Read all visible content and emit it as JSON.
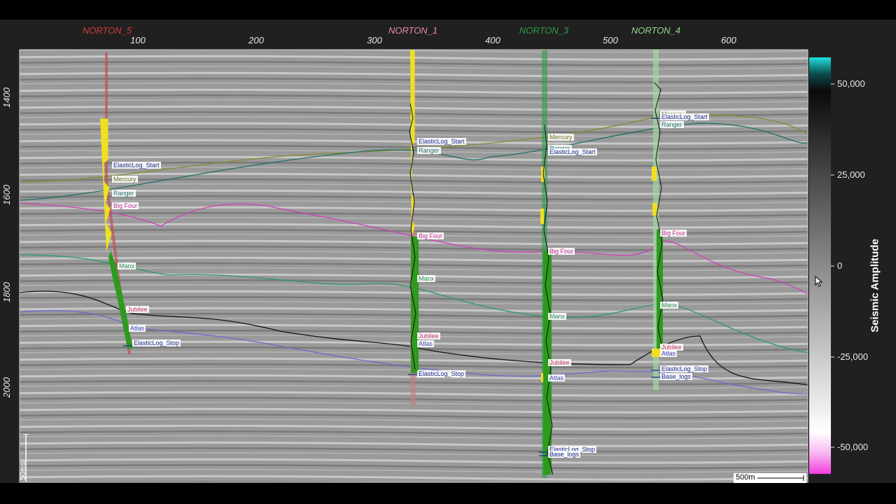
{
  "wells": [
    {
      "name": "NORTON_5",
      "color": "#d63a3a"
    },
    {
      "name": "NORTON_1",
      "color": "#e88aa8"
    },
    {
      "name": "NORTON_3",
      "color": "#2e9e4a"
    },
    {
      "name": "NORTON_4",
      "color": "#8fd88f"
    }
  ],
  "x_axis": {
    "ticks": [
      "100",
      "200",
      "300",
      "400",
      "500",
      "600"
    ]
  },
  "y_axis": {
    "ticks": [
      "1400",
      "1600",
      "1800",
      "2000"
    ]
  },
  "horizons": {
    "mercury": "Mercury",
    "ranger": "Ranger",
    "big_four": "Big Four",
    "manx": "Manx",
    "jubilee": "Jubilee",
    "atlas": "Atlas",
    "elastic_start": "ElasticLog_Start",
    "elastic_stop": "ElasticLog_Stop",
    "base_logs": "Base_logs"
  },
  "colorbar": {
    "title": "Seismic Amplitude",
    "ticks": [
      "50,000",
      "25,000",
      "0",
      "-25,000",
      "-50,000"
    ]
  },
  "scalebars": {
    "vertical": "50ms",
    "horizontal": "500m"
  }
}
